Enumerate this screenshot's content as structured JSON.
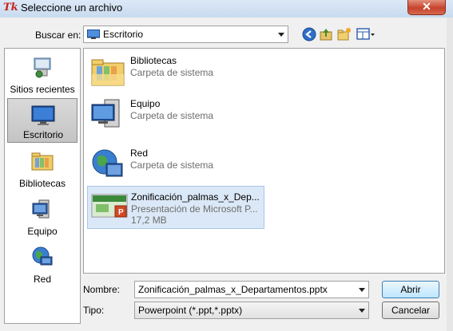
{
  "window": {
    "tk_glyph": "Tk",
    "title": "Seleccione un archivo",
    "close_glyph": "✕"
  },
  "toolbar": {
    "buscar_label": "Buscar en:",
    "location_value": "Escritorio",
    "icons": [
      "back-arrow-icon",
      "up-folder-icon",
      "new-folder-icon",
      "view-menu-icon"
    ]
  },
  "places": [
    {
      "label": "Sitios recientes",
      "icon": "recent-places-icon"
    },
    {
      "label": "Escritorio",
      "icon": "desktop-icon",
      "selected": true
    },
    {
      "label": "Bibliotecas",
      "icon": "libraries-icon"
    },
    {
      "label": "Equipo",
      "icon": "computer-icon"
    },
    {
      "label": "Red",
      "icon": "network-icon"
    }
  ],
  "files": [
    {
      "name": "Bibliotecas",
      "sub": "Carpeta de sistema",
      "sub2": "",
      "icon": "libraries-folder-icon"
    },
    {
      "name": "Equipo",
      "sub": "Carpeta de sistema",
      "sub2": "",
      "icon": "computer-icon"
    },
    {
      "name": "Red",
      "sub": "Carpeta de sistema",
      "sub2": "",
      "icon": "network-icon"
    },
    {
      "name": "Zonificación_palmas_x_Dep...",
      "sub": "Presentación de Microsoft P...",
      "sub2": "17,2 MB",
      "icon": "powerpoint-file-icon",
      "selected": true
    }
  ],
  "bottom": {
    "nombre_label": "Nombre:",
    "nombre_value": "Zonificación_palmas_x_Departamentos.pptx",
    "tipo_label": "Tipo:",
    "tipo_value": "Powerpoint (*.ppt,*.pptx)",
    "open_label": "Abrir",
    "cancel_label": "Cancelar"
  },
  "colors": {
    "title_bg": "#c8dbef",
    "selected_item": "#dbe8f7",
    "close_red": "#c7422b"
  }
}
